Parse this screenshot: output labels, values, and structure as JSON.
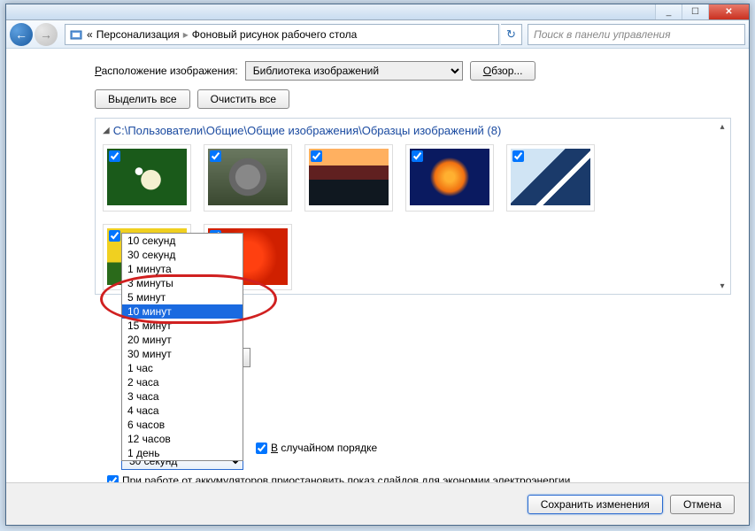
{
  "titlebar": {
    "min": "_",
    "max": "☐",
    "close": "✕"
  },
  "nav": {
    "back": "←",
    "fwd": "→",
    "crumb_prefix": "«",
    "crumb1": "Персонализация",
    "crumb2": "Фоновый рисунок рабочего стола",
    "refresh": "↻",
    "search_placeholder": "Поиск в панели управления"
  },
  "location_label": "Расположение изображения:",
  "location_value": "Библиотека изображений",
  "browse": "Обзор...",
  "select_all": "Выделить все",
  "clear_all": "Очистить все",
  "gallery_path": "C:\\Пользователи\\Общие\\Общие изображения\\Образцы изображений (8)",
  "interval_options": [
    "10 секунд",
    "30 секунд",
    "1 минута",
    "3 минуты",
    "5 минут",
    "10 минут",
    "15 минут",
    "20 минут",
    "30 минут",
    "1 час",
    "2 часа",
    "3 часа",
    "4 часа",
    "6 часов",
    "12 часов",
    "1 день"
  ],
  "interval_selected": "10 минут",
  "interval_combo_value": "30 секунд",
  "shuffle_label": "В случайном порядке",
  "battery_label": "При работе от аккумуляторов приостановить показ слайдов для экономии электроэнергии",
  "save": "Сохранить изменения",
  "cancel": "Отмена"
}
